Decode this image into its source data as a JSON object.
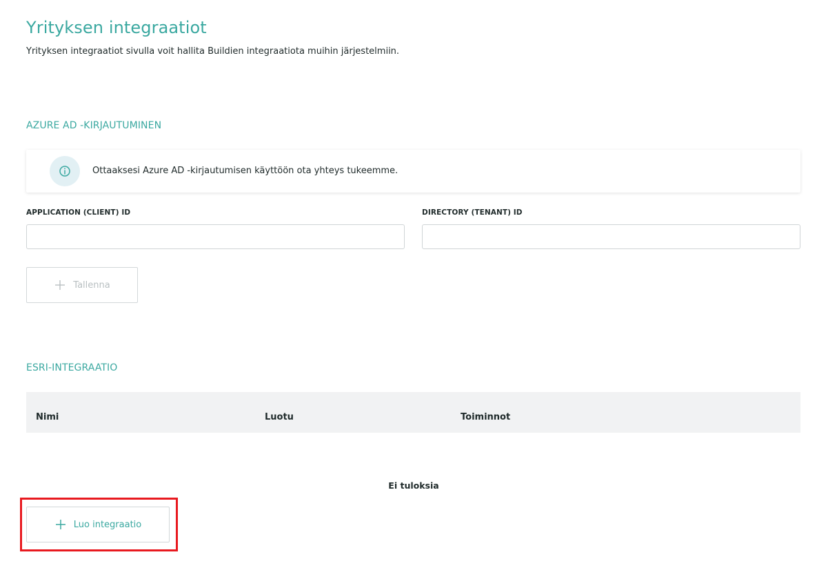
{
  "page": {
    "title": "Yrityksen integraatiot",
    "description": "Yrityksen integraatiot sivulla voit hallita Buildien integraatiota muihin järjestelmiin."
  },
  "azure": {
    "section_title": "AZURE AD -KIRJAUTUMINEN",
    "info_text": "Ottaaksesi Azure AD -kirjautumisen käyttöön ota yhteys tukeemme.",
    "client_id_label": "APPLICATION (CLIENT) ID",
    "client_id_value": "",
    "tenant_id_label": "DIRECTORY (TENANT) ID",
    "tenant_id_value": "",
    "save_label": "Tallenna",
    "save_icon": "plus-icon"
  },
  "esri": {
    "section_title": "ESRI-INTEGRAATIO",
    "columns": [
      "Nimi",
      "Luotu",
      "Toiminnot"
    ],
    "rows": [],
    "empty_text": "Ei tuloksia",
    "create_label": "Luo integraatio",
    "create_icon": "plus-icon"
  },
  "colors": {
    "accent": "#3aa8a0",
    "highlight": "#e8191f",
    "disabled": "#b8bfc1"
  }
}
